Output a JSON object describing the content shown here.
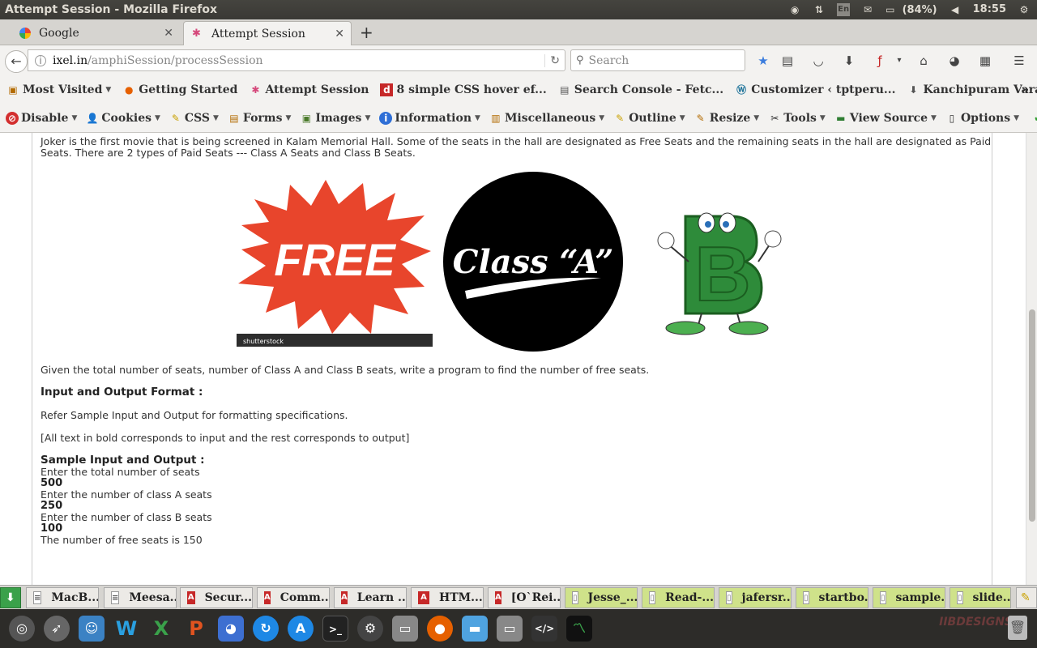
{
  "window": {
    "title": "Attempt Session - Mozilla Firefox"
  },
  "tray": {
    "lang": "En",
    "battery": "(84%)",
    "time": "18:55"
  },
  "tabs": [
    {
      "label": "Google"
    },
    {
      "label": "Attempt Session"
    }
  ],
  "nav": {
    "url_domain": "ixel.in",
    "url_path": "/amphiSession/processSession",
    "search_placeholder": "Search"
  },
  "bookmarks": [
    {
      "label": "Most Visited",
      "icon": "gear-folder-icon",
      "caret": true
    },
    {
      "label": "Getting Started",
      "icon": "firefox-icon"
    },
    {
      "label": "Attempt Session",
      "icon": "app-icon"
    },
    {
      "label": "8 simple CSS hover ef...",
      "icon": "d-icon"
    },
    {
      "label": "Search Console - Fetc...",
      "icon": "console-icon"
    },
    {
      "label": "Customizer ‹ tptperu...",
      "icon": "wordpress-icon"
    },
    {
      "label": "Kanchipuram Varada...",
      "icon": "download-icon"
    }
  ],
  "webdev": [
    {
      "label": "Disable",
      "icon": "disable-icon"
    },
    {
      "label": "Cookies",
      "icon": "cookies-icon"
    },
    {
      "label": "CSS",
      "icon": "css-icon"
    },
    {
      "label": "Forms",
      "icon": "forms-icon"
    },
    {
      "label": "Images",
      "icon": "images-icon"
    },
    {
      "label": "Information",
      "icon": "info-icon"
    },
    {
      "label": "Miscellaneous",
      "icon": "misc-icon"
    },
    {
      "label": "Outline",
      "icon": "outline-icon"
    },
    {
      "label": "Resize",
      "icon": "resize-icon"
    },
    {
      "label": "Tools",
      "icon": "tools-icon"
    },
    {
      "label": "View Source",
      "icon": "source-icon"
    },
    {
      "label": "Options",
      "icon": "options-icon"
    }
  ],
  "page": {
    "intro1": "Joker is the first movie that is being screened in Kalam Memorial Hall. Some of the seats in the hall are designated as Free Seats and the remaining seats in the hall are designated as Paid",
    "intro2": "Seats. There are 2 types of Paid Seats --- Class A Seats and Class B Seats.",
    "img_free": "FREE",
    "img_stock": "shutterstock",
    "img_classa": "Class “A”",
    "img_b": "B",
    "given": "Given the total number of seats, number of Class A and Class B seats, write a program to find the number of free seats.",
    "io_heading": "Input and Output Format :",
    "refer": "Refer Sample Input and Output for formatting specifications.",
    "note": "[All text in bold corresponds to input and the rest corresponds to output]",
    "sample_heading": "Sample Input and Output :",
    "s1": "Enter the total number of seats",
    "s2": "500",
    "s3": "Enter the number of class A seats",
    "s4": "250",
    "s5": "Enter the number of class B seats",
    "s6": "100",
    "s7": "The number of free seats is 150"
  },
  "downloads": [
    {
      "label": "MacB...",
      "kind": "page"
    },
    {
      "label": "Meesa...",
      "kind": "page"
    },
    {
      "label": "Secur...",
      "kind": "pdf"
    },
    {
      "label": "Comm...",
      "kind": "pdf"
    },
    {
      "label": "Learn ...",
      "kind": "pdf"
    },
    {
      "label": "HTM...",
      "kind": "pdf"
    },
    {
      "label": "[O`Rei...",
      "kind": "pdf"
    },
    {
      "label": "Jesse_...",
      "kind": "file"
    },
    {
      "label": "Read-...",
      "kind": "file"
    },
    {
      "label": "jafersr...",
      "kind": "file"
    },
    {
      "label": "startbo...",
      "kind": "file"
    },
    {
      "label": "sample...",
      "kind": "file"
    },
    {
      "label": "slide...",
      "kind": "file"
    }
  ],
  "brand": "IIBDESIGNS",
  "colors": {
    "accent_blue": "#3b7ddd",
    "free_red": "#e8452c",
    "b_green": "#2e8b3a",
    "file_green": "#cfe28a"
  }
}
